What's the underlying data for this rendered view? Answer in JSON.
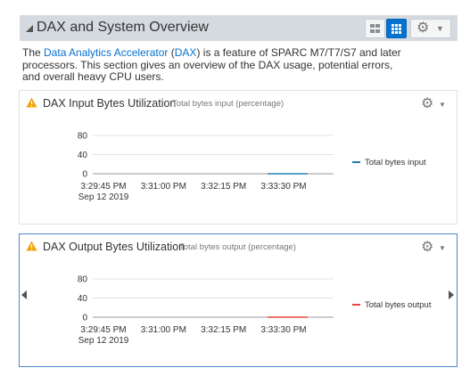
{
  "header": {
    "title": "DAX and System Overview",
    "views": [
      "grid-view-icon",
      "tiles-view-icon"
    ],
    "settings_icon": "gear-icon"
  },
  "description": {
    "prefix": "The ",
    "link1": "Data Analytics Accelerator",
    "mid": " (",
    "link2": "DAX",
    "suffix": ") is a feature of SPARC M7/T7/S7 and later processors. This section gives an overview of the DAX usage, potential errors, and overall heavy CPU users."
  },
  "panels": [
    {
      "title": "DAX Input Bytes Utilization",
      "subtitle": "Total bytes input (percentage)",
      "icon": "warning-icon"
    },
    {
      "title": "DAX Output Bytes Utilization",
      "subtitle": "Total bytes output (percentage)",
      "icon": "warning-icon"
    }
  ],
  "chart_data": [
    {
      "type": "line",
      "title": "DAX Input Bytes Utilization",
      "subtitle": "Total bytes input (percentage)",
      "yticks": [
        "80",
        "40",
        "0"
      ],
      "ylim": [
        0,
        100
      ],
      "xticks": [
        "3:29:45 PM",
        "3:31:00 PM",
        "3:32:15 PM",
        "3:33:30 PM"
      ],
      "x_date": "Sep 12 2019",
      "series": [
        {
          "name": "Total bytes input",
          "color": "#267db3",
          "points": [
            {
              "x": "3:33:10 PM",
              "y": 0
            },
            {
              "x": "3:34:00 PM",
              "y": 0
            }
          ]
        }
      ],
      "legend": "right",
      "grid": true
    },
    {
      "type": "line",
      "title": "DAX Output Bytes Utilization",
      "subtitle": "Total bytes output (percentage)",
      "yticks": [
        "80",
        "40",
        "0"
      ],
      "ylim": [
        0,
        100
      ],
      "xticks": [
        "3:29:45 PM",
        "3:31:00 PM",
        "3:32:15 PM",
        "3:33:30 PM"
      ],
      "x_date": "Sep 12 2019",
      "series": [
        {
          "name": "Total bytes output",
          "color": "#e8453c",
          "points": [
            {
              "x": "3:33:10 PM",
              "y": 0
            },
            {
              "x": "3:34:00 PM",
              "y": 0
            }
          ]
        }
      ],
      "legend": "right",
      "grid": true
    }
  ]
}
